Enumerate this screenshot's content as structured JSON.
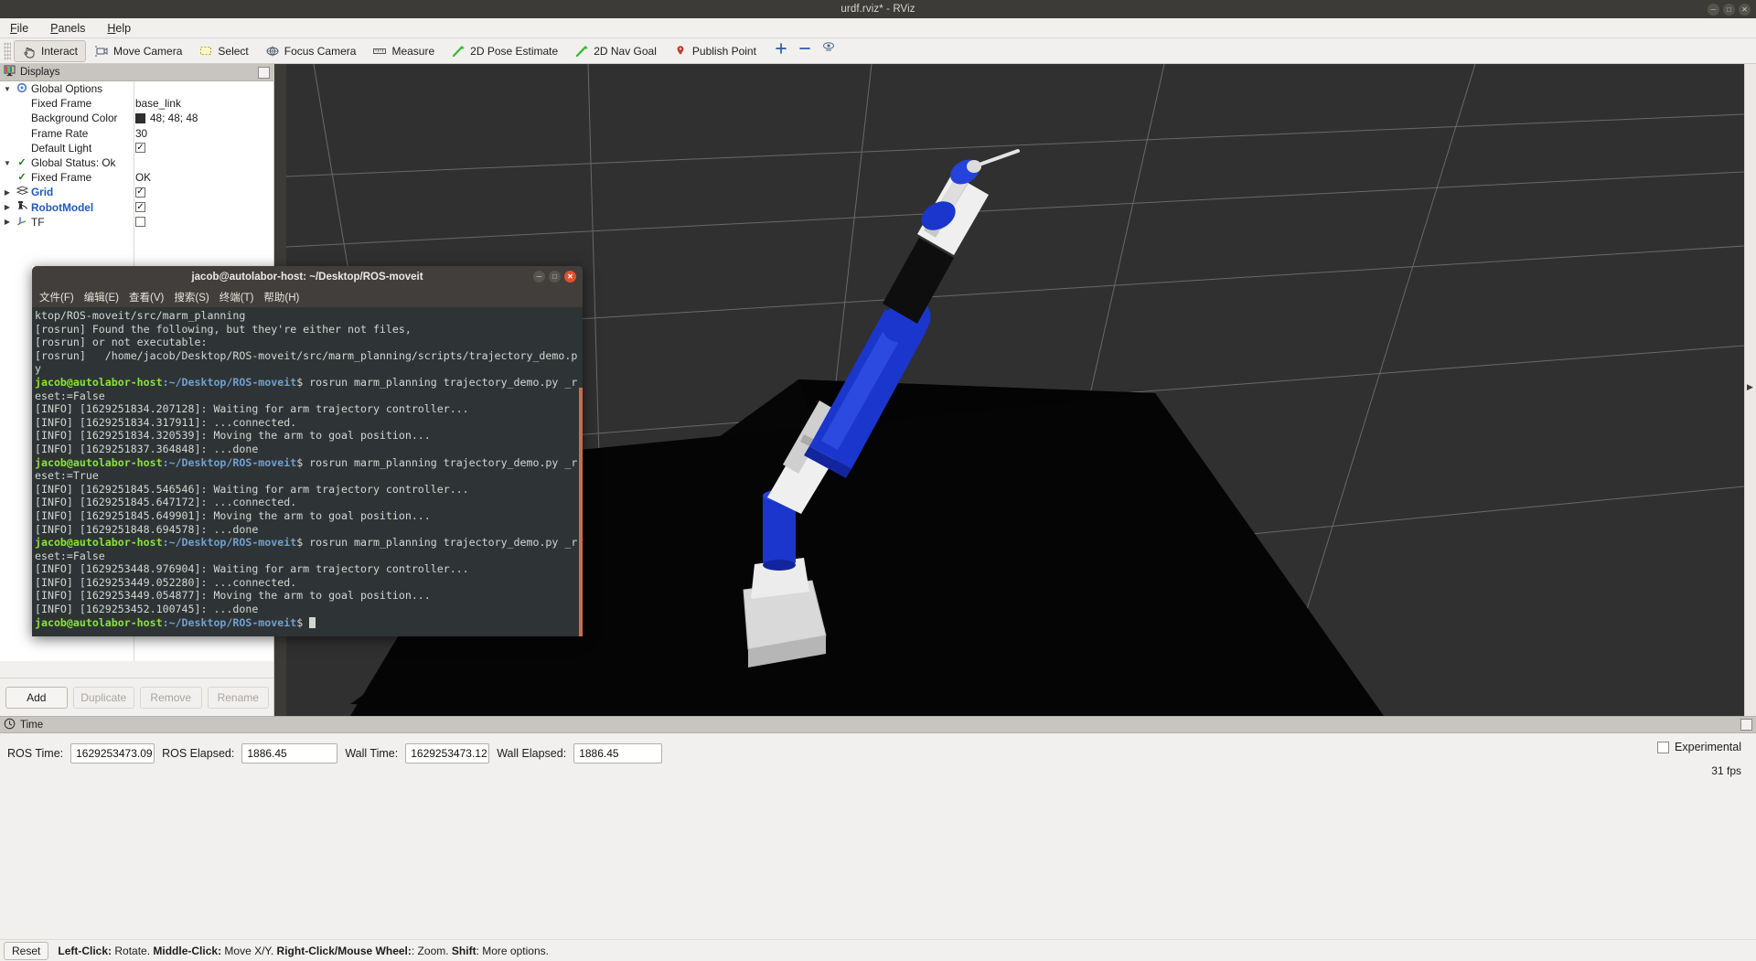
{
  "window": {
    "title": "urdf.rviz* - RViz",
    "controls": [
      "minimize",
      "maximize",
      "close"
    ]
  },
  "menubar": {
    "items": [
      {
        "label": "File",
        "mnemonic": "F"
      },
      {
        "label": "Panels",
        "mnemonic": "P"
      },
      {
        "label": "Help",
        "mnemonic": "H"
      }
    ]
  },
  "toolbar": {
    "buttons": [
      {
        "label": "Interact",
        "icon": "hand-cursor-icon",
        "active": true
      },
      {
        "label": "Move Camera",
        "icon": "move-camera-icon",
        "active": false
      },
      {
        "label": "Select",
        "icon": "selection-rectangle-icon",
        "active": false
      },
      {
        "label": "Focus Camera",
        "icon": "focus-camera-icon",
        "active": false
      },
      {
        "label": "Measure",
        "icon": "ruler-icon",
        "active": false
      },
      {
        "label": "2D Pose Estimate",
        "icon": "green-arrow-icon",
        "active": false
      },
      {
        "label": "2D Nav Goal",
        "icon": "green-arrow-icon",
        "active": false
      },
      {
        "label": "Publish Point",
        "icon": "map-pin-icon",
        "active": false
      }
    ],
    "extra_icons": [
      "plus-icon",
      "minus-icon",
      "eye-icon"
    ]
  },
  "displays": {
    "title": "Displays",
    "rows": [
      {
        "indent": 0,
        "arrow": "down",
        "icon": "gear-icon",
        "label": "Global Options",
        "style": "plain",
        "value_type": "none",
        "value": ""
      },
      {
        "indent": 1,
        "arrow": "none",
        "icon": "none",
        "label": "Fixed Frame",
        "style": "plain",
        "value_type": "text",
        "value": "base_link"
      },
      {
        "indent": 1,
        "arrow": "none",
        "icon": "none",
        "label": "Background Color",
        "style": "plain",
        "value_type": "color",
        "value": "48; 48; 48",
        "color": "#303030"
      },
      {
        "indent": 1,
        "arrow": "none",
        "icon": "none",
        "label": "Frame Rate",
        "style": "plain",
        "value_type": "text",
        "value": "30"
      },
      {
        "indent": 1,
        "arrow": "none",
        "icon": "none",
        "label": "Default Light",
        "style": "plain",
        "value_type": "checkbox",
        "checked": true
      },
      {
        "indent": 0,
        "arrow": "down",
        "icon": "check-icon",
        "label": "Global Status: Ok",
        "style": "plain",
        "value_type": "none",
        "value": ""
      },
      {
        "indent": 1,
        "arrow": "none",
        "icon": "check-icon",
        "label": "Fixed Frame",
        "style": "plain",
        "value_type": "text",
        "value": "OK"
      },
      {
        "indent": 0,
        "arrow": "right",
        "icon": "grid-icon",
        "label": "Grid",
        "style": "link",
        "value_type": "checkbox",
        "checked": true
      },
      {
        "indent": 0,
        "arrow": "right",
        "icon": "robot-icon",
        "label": "RobotModel",
        "style": "link",
        "value_type": "checkbox",
        "checked": true
      },
      {
        "indent": 0,
        "arrow": "right",
        "icon": "axes-icon",
        "label": "TF",
        "style": "link",
        "value_type": "checkbox",
        "checked": false
      }
    ],
    "buttons": [
      {
        "label": "Add",
        "enabled": true
      },
      {
        "label": "Duplicate",
        "enabled": false
      },
      {
        "label": "Remove",
        "enabled": false
      },
      {
        "label": "Rename",
        "enabled": false
      }
    ]
  },
  "view3d": {
    "background_color": "#303030",
    "grid_color": "#7d7d7d",
    "ground_plane_color": "#050505",
    "robot_colors": {
      "blue": "#1634cc",
      "white": "#e8e8e8",
      "black": "#101010",
      "light_gray": "#c8c8c8"
    }
  },
  "time": {
    "title": "Time",
    "fields": [
      {
        "label": "ROS Time:",
        "value": "1629253473.09"
      },
      {
        "label": "ROS Elapsed:",
        "value": "1886.45"
      },
      {
        "label": "Wall Time:",
        "value": "1629253473.12"
      },
      {
        "label": "Wall Elapsed:",
        "value": "1886.45"
      }
    ],
    "experimental_label": "Experimental",
    "experimental_checked": false,
    "fps": "31 fps"
  },
  "statusbar": {
    "reset_label": "Reset",
    "hint_segments": [
      {
        "text": "Left-Click:",
        "bold": true
      },
      {
        "text": " Rotate. ",
        "bold": false
      },
      {
        "text": "Middle-Click:",
        "bold": true
      },
      {
        "text": " Move X/Y. ",
        "bold": false
      },
      {
        "text": "Right-Click/Mouse Wheel:",
        "bold": true
      },
      {
        "text": ": Zoom. ",
        "bold": false
      },
      {
        "text": "Shift",
        "bold": true
      },
      {
        "text": ": More options.",
        "bold": false
      }
    ]
  },
  "terminal": {
    "title": "jacob@autolabor-host: ~/Desktop/ROS-moveit",
    "menu": [
      "文件(F)",
      "编辑(E)",
      "查看(V)",
      "搜索(S)",
      "终端(T)",
      "帮助(H)"
    ],
    "lines": [
      {
        "type": "plain",
        "text": "ktop/ROS-moveit/src/marm_planning"
      },
      {
        "type": "plain",
        "text": "[rosrun] Found the following, but they're either not files,"
      },
      {
        "type": "plain",
        "text": "[rosrun] or not executable:"
      },
      {
        "type": "plain",
        "text": "[rosrun]   /home/jacob/Desktop/ROS-moveit/src/marm_planning/scripts/trajectory_demo.py"
      },
      {
        "type": "prompt",
        "user": "jacob@autolabor-host",
        "path": ":~/Desktop/ROS-moveit",
        "cmd": "$ rosrun marm_planning trajectory_demo.py _reset:=False"
      },
      {
        "type": "plain",
        "text": "[INFO] [1629251834.207128]: Waiting for arm trajectory controller..."
      },
      {
        "type": "plain",
        "text": "[INFO] [1629251834.317911]: ...connected."
      },
      {
        "type": "plain",
        "text": "[INFO] [1629251834.320539]: Moving the arm to goal position..."
      },
      {
        "type": "plain",
        "text": "[INFO] [1629251837.364848]: ...done"
      },
      {
        "type": "prompt",
        "user": "jacob@autolabor-host",
        "path": ":~/Desktop/ROS-moveit",
        "cmd": "$ rosrun marm_planning trajectory_demo.py _reset:=True"
      },
      {
        "type": "plain",
        "text": "[INFO] [1629251845.546546]: Waiting for arm trajectory controller..."
      },
      {
        "type": "plain",
        "text": "[INFO] [1629251845.647172]: ...connected."
      },
      {
        "type": "plain",
        "text": "[INFO] [1629251845.649901]: Moving the arm to goal position..."
      },
      {
        "type": "plain",
        "text": "[INFO] [1629251848.694578]: ...done"
      },
      {
        "type": "prompt",
        "user": "jacob@autolabor-host",
        "path": ":~/Desktop/ROS-moveit",
        "cmd": "$ rosrun marm_planning trajectory_demo.py _reset:=False"
      },
      {
        "type": "plain",
        "text": "[INFO] [1629253448.976904]: Waiting for arm trajectory controller..."
      },
      {
        "type": "plain",
        "text": "[INFO] [1629253449.052280]: ...connected."
      },
      {
        "type": "plain",
        "text": "[INFO] [1629253449.054877]: Moving the arm to goal position..."
      },
      {
        "type": "plain",
        "text": "[INFO] [1629253452.100745]: ...done"
      },
      {
        "type": "prompt-cursor",
        "user": "jacob@autolabor-host",
        "path": ":~/Desktop/ROS-moveit",
        "cmd": "$ "
      }
    ]
  }
}
